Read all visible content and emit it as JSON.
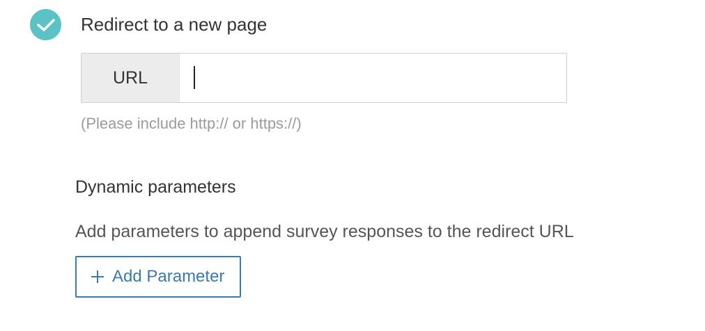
{
  "redirect_option": {
    "label": "Redirect to a new page",
    "selected": true,
    "check_color": "#5bc2c5",
    "icon": "checkmark-icon"
  },
  "url_field": {
    "addon_label": "URL",
    "value": "",
    "hint": "(Please include http:// or https://)"
  },
  "dynamic_parameters": {
    "title": "Dynamic parameters",
    "description": "Add parameters to append survey responses to the redirect URL",
    "add_button": {
      "label": "Add Parameter",
      "icon": "plus-icon",
      "color": "#3a79b1"
    }
  }
}
